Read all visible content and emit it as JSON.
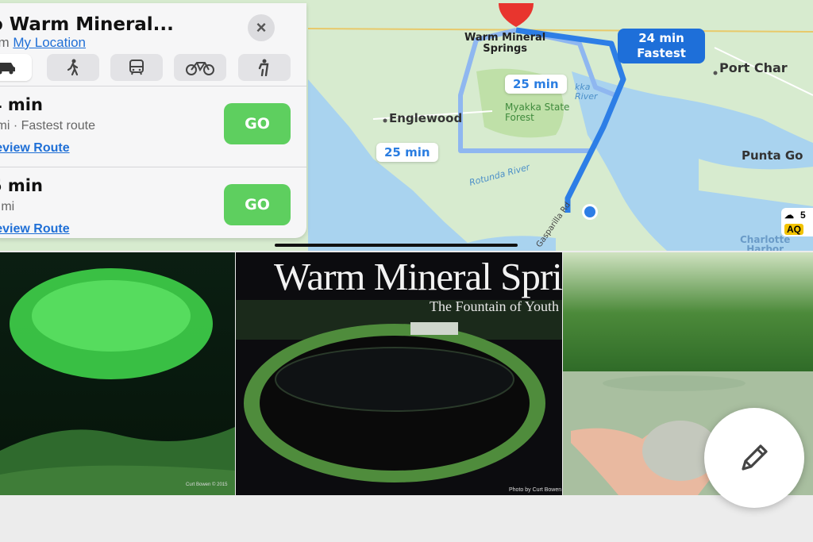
{
  "panel": {
    "title": "o Warm Mineral...",
    "from_prefix": "om",
    "from_link": "My Location",
    "close_glyph": "×",
    "modes": [
      "drive-icon",
      "walk-icon",
      "transit-icon",
      "bike-icon",
      "ride-icon"
    ],
    "routes": [
      {
        "time": "4 min",
        "info": "' mi · Fastest route",
        "preview": "review Route",
        "go": "GO"
      },
      {
        "time": "5 min",
        "info": "0 mi",
        "preview": "review Route",
        "go": "GO"
      }
    ]
  },
  "map": {
    "destination": "Warm Mineral Springs",
    "destination_line1": "Warm Mineral",
    "destination_line2": "Springs",
    "fastest_time": "24 min",
    "fastest_label": "Fastest",
    "alt_time_1": "25 min",
    "alt_time_2": "25 min",
    "places": {
      "englewood": "Englewood",
      "port_charlotte": "Port Char",
      "punta_gorda": "Punta Go",
      "myakka_line1": "Myakka State",
      "myakka_line2": "Forest",
      "rotunda": "Rotunda River",
      "gasparilla": "Gasparilla Rd",
      "charlotte_line1": "Charlotte",
      "charlotte_line2": "Harbor",
      "myakka_river_a": "kka",
      "myakka_river_b": "River",
      "weather_temp": "5",
      "aqi": "AQ"
    }
  },
  "photos": {
    "photo2_title": "Warm Mineral Springs",
    "photo2_subtitle": "The Fountain of Youth",
    "photo1_credit": "Curt Bowen © 2015",
    "photo2_credit": "Photo by Curt Bowen"
  },
  "fab": {
    "icon": "pencil-icon"
  }
}
